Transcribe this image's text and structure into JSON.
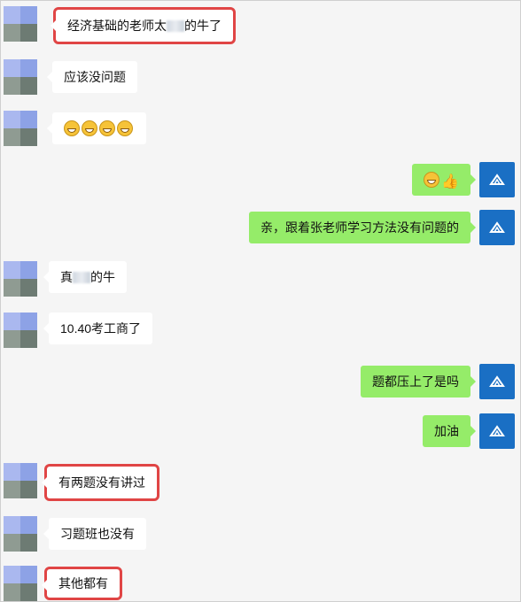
{
  "messages": [
    {
      "side": "left",
      "before": "经济基础的老师太",
      "after": "的牛了",
      "highlight": true
    },
    {
      "side": "left",
      "text": "应该没问题"
    },
    {
      "side": "left",
      "emoji_count": 4
    },
    {
      "side": "right",
      "emoji": "smile-thumbs-up"
    },
    {
      "side": "right",
      "text": "亲，跟着张老师学习方法没有问题的"
    },
    {
      "side": "left",
      "before": "真",
      "after": "的牛"
    },
    {
      "side": "left",
      "text": "10.40考工商了"
    },
    {
      "side": "right",
      "text": "题都压上了是吗"
    },
    {
      "side": "right",
      "text": "加油"
    },
    {
      "side": "left",
      "text": "有两题没有讲过",
      "highlight": true
    },
    {
      "side": "left",
      "text": "习题班也没有"
    },
    {
      "side": "left",
      "text": "其他都有",
      "highlight": true
    }
  ],
  "colors": {
    "left_bubble": "#ffffff",
    "right_bubble": "#95ec69",
    "highlight": "#e04545",
    "brand_avatar": "#1a6fc4"
  },
  "icons": {
    "emoji": "grinning-face-icon",
    "thumb": "thumbs-up-icon",
    "avatar": "brand-logo-icon"
  }
}
